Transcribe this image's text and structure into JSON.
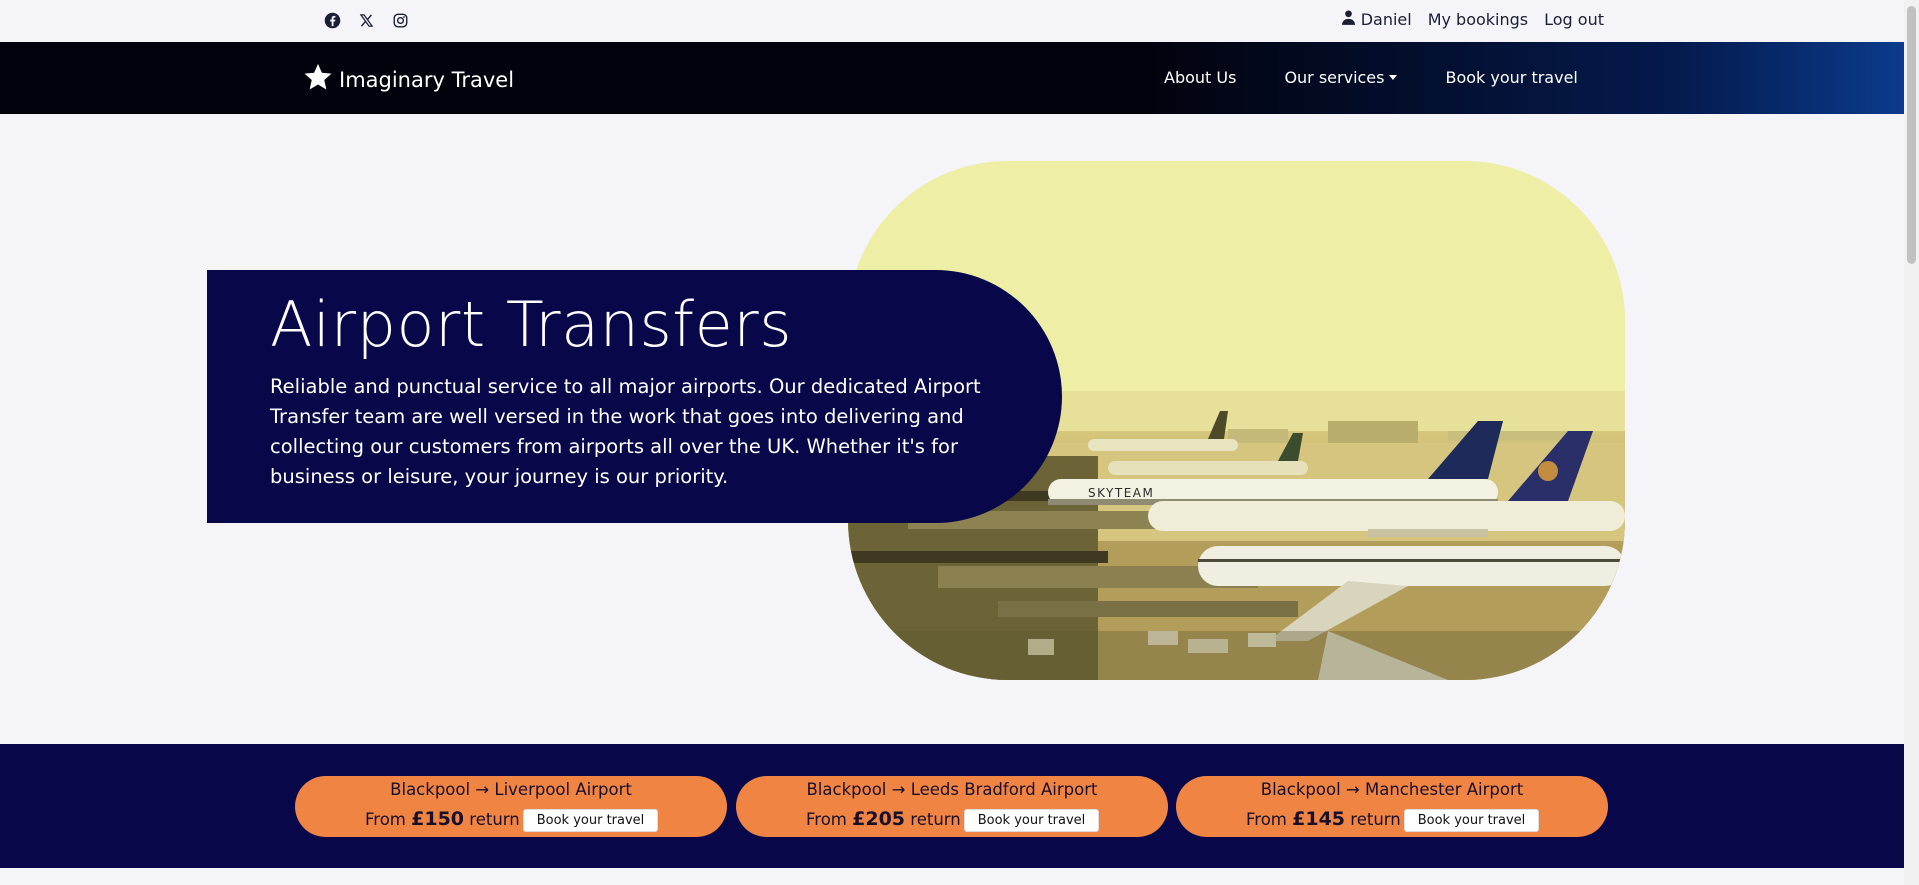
{
  "social": {
    "icons": [
      "facebook-icon",
      "x-icon",
      "instagram-icon"
    ]
  },
  "account": {
    "user_name": "Daniel",
    "my_bookings": "My bookings",
    "logout": "Log out"
  },
  "navbar": {
    "brand": "Imaginary Travel",
    "links": {
      "about": "About Us",
      "services": "Our services",
      "book": "Book your travel"
    }
  },
  "hero": {
    "title": "Airport Transfers",
    "text": "Reliable and punctual service to all major airports. Our dedicated Airport Transfer team are well versed in the work that goes into delivering and collecting our customers from airports all over the UK. Whether it's for business or leisure, your journey is our priority.",
    "image_caption_text": "SKYTEAM"
  },
  "routes": [
    {
      "name": "Blackpool → Liverpool Airport",
      "from": "From",
      "price": "£150",
      "suffix": "return",
      "button": "Book your travel"
    },
    {
      "name": "Blackpool → Leeds Bradford Airport",
      "from": "From",
      "price": "£205",
      "suffix": "return",
      "button": "Book your travel"
    },
    {
      "name": "Blackpool → Manchester Airport",
      "from": "From",
      "price": "£145",
      "suffix": "return",
      "button": "Book your travel"
    }
  ],
  "colors": {
    "navy": "#08074a",
    "orange": "#ef8443",
    "navbar_dark": "#02020c",
    "navbar_blue": "#0b3b8c",
    "page_bg": "#f4f4f9"
  }
}
